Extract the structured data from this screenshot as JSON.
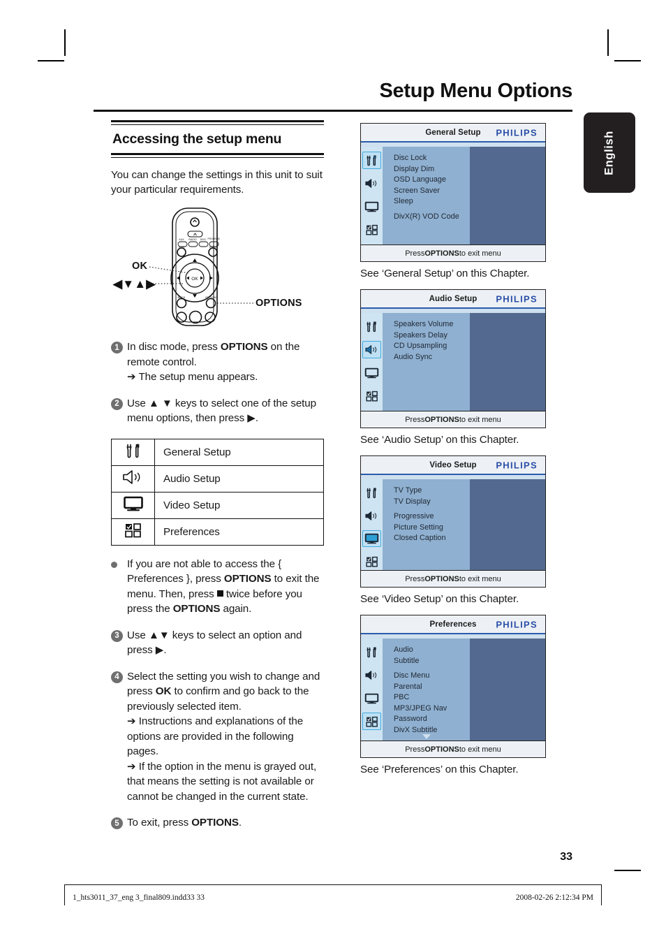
{
  "header": {
    "doc_title": "Setup Menu Options",
    "language_tab": "English"
  },
  "section": {
    "title": "Accessing the setup menu",
    "intro": "You can change the settings in this unit to suit your particular requirements."
  },
  "remote": {
    "callout_ok": "OK",
    "callout_navkeys": "◀▼▲▶",
    "callout_options": "OPTIONS"
  },
  "steps": [
    {
      "num": "1",
      "text_before": "In disc mode, press ",
      "bold": "OPTIONS",
      "text_after": " on the remote control.",
      "sub1": "➔ The setup menu appears."
    },
    {
      "num": "2",
      "text": "Use ▲ ▼ keys to select one of the setup menu options, then press ▶."
    },
    {
      "num": "3",
      "text": "Use ▲▼ keys to select an option and press ▶."
    },
    {
      "num": "4",
      "text_before": "Select the setting you wish to change and press ",
      "bold": "OK",
      "text_after": " to confirm and go back to the previously selected item.",
      "sub1": "➔ Instructions and explanations of the options are provided in the following pages.",
      "sub2": "➔ If the option in the menu is grayed out, that means the setting is not available or cannot be changed in the current state."
    },
    {
      "num": "5",
      "text_before": "To exit, press ",
      "bold": "OPTIONS",
      "text_after": "."
    }
  ],
  "note_bullet": {
    "part1": "If you are not able to access the { Preferences }, press ",
    "bold1": "OPTIONS",
    "part2": " to exit the menu. Then, press ",
    "part3": " twice before you press the ",
    "bold2": "OPTIONS",
    "part4": " again."
  },
  "setup_table": {
    "rows": [
      {
        "icon": "tools-icon",
        "label": "General Setup"
      },
      {
        "icon": "speaker-icon",
        "label": "Audio Setup"
      },
      {
        "icon": "monitor-icon",
        "label": "Video Setup"
      },
      {
        "icon": "squares-icon",
        "label": "Preferences"
      }
    ]
  },
  "screens": [
    {
      "title": "General Setup",
      "brand": "PHILIPS",
      "selected_rail": 0,
      "items": [
        "Disc Lock",
        "Display Dim",
        "OSD Language",
        "Screen Saver",
        "Sleep"
      ],
      "items_gap": [
        "DivX(R) VOD Code"
      ],
      "more_arrow": false,
      "footer_before": "Press ",
      "footer_bold": "OPTIONS",
      "footer_after": " to exit menu",
      "caption": "See ‘General Setup’ on this Chapter.",
      "body_height": 140
    },
    {
      "title": "Audio Setup",
      "brand": "PHILIPS",
      "selected_rail": 1,
      "items": [
        "Speakers Volume",
        "Speakers Delay",
        "CD Upsampling",
        "Audio Sync"
      ],
      "items_gap": [],
      "more_arrow": false,
      "footer_before": "Press ",
      "footer_bold": "OPTIONS",
      "footer_after": " to exit menu",
      "caption": "See ‘Audio Setup’ on this Chapter.",
      "body_height": 140
    },
    {
      "title": "Video Setup",
      "brand": "PHILIPS",
      "selected_rail": 2,
      "items": [
        "TV Type",
        "TV Display"
      ],
      "items_gap": [
        "Progressive",
        "Picture Setting",
        "Closed Caption"
      ],
      "more_arrow": false,
      "footer_before": "Press ",
      "footer_bold": "OPTIONS",
      "footer_after": " to exit menu",
      "caption": "See ‘Video Setup’ on this Chapter.",
      "body_height": 130
    },
    {
      "title": "Preferences",
      "brand": "PHILIPS",
      "selected_rail": 3,
      "items": [
        "Audio",
        "Subtitle"
      ],
      "items_gap": [
        "Disc Menu",
        "Parental",
        "PBC",
        "MP3/JPEG Nav",
        "Password",
        "DivX Subtitle"
      ],
      "more_arrow": true,
      "footer_before": "Press ",
      "footer_bold": "OPTIONS",
      "footer_after": " to exit menu",
      "caption": "See ‘Preferences’ on this Chapter.",
      "body_height": 146
    }
  ],
  "footer": {
    "page_number": "33",
    "file_info": "1_hts3011_37_eng 3_final809.indd33   33",
    "timestamp": "2008-02-26   2:12:34 PM"
  },
  "colors": {
    "rail_bg": "#cfe4f2",
    "list_bg": "#8fb0d0",
    "dark_pane": "#53698f",
    "philips_blue": "#2a4fa8",
    "select_border": "#3fa9dd"
  }
}
